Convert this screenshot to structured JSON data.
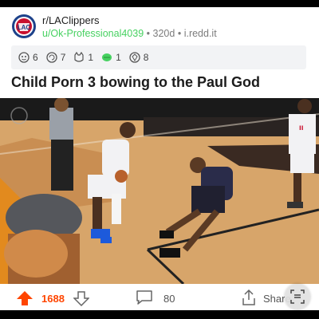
{
  "post": {
    "subreddit": "r/LAClippers",
    "user": "u/Ok-Professional4039",
    "age": "320d",
    "domain": "i.redd.it",
    "separator": "•",
    "title": "Child Porn 3 bowing to the Paul God"
  },
  "awards": [
    {
      "icon": "award-face-icon",
      "count": "6"
    },
    {
      "icon": "award-swirl-icon",
      "count": "7"
    },
    {
      "icon": "award-cat-icon",
      "count": "1"
    },
    {
      "icon": "award-leaf-icon",
      "count": "1"
    },
    {
      "icon": "award-gem-icon",
      "count": "8"
    }
  ],
  "actions": {
    "score": "1688",
    "comments": "80",
    "share_label": "Share"
  },
  "colors": {
    "upvote": "#ff4500",
    "username": "#46d160",
    "clippers_red": "#c8102e",
    "clippers_blue": "#1d428a",
    "court": "#d8a86c"
  }
}
